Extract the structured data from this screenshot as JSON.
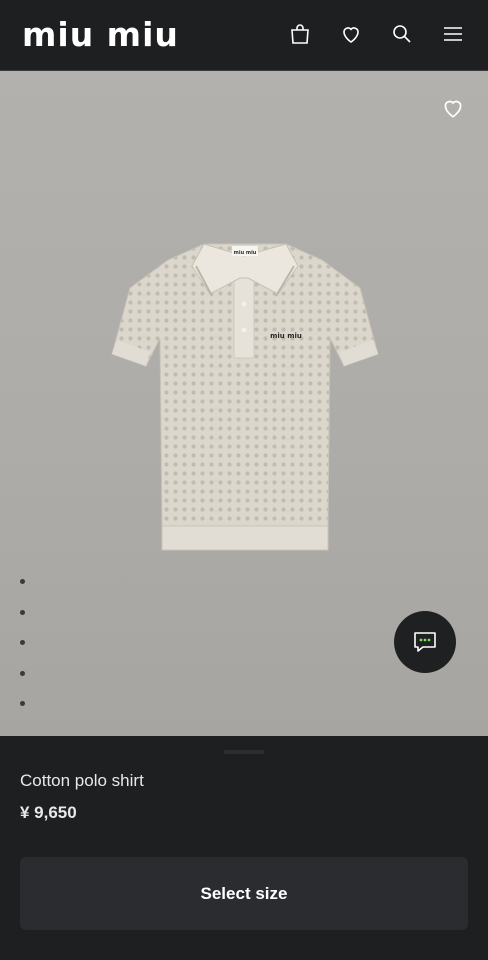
{
  "header": {
    "logo_text": "miu miu",
    "icons": [
      "shopping-bag-icon",
      "heart-icon",
      "search-icon",
      "menu-icon"
    ]
  },
  "product": {
    "name": "Cotton polo shirt",
    "price": "¥ 9,650",
    "image_alt": "Cotton polo shirt",
    "gallery_count": 5,
    "gallery_active_index": 0,
    "select_size_label": "Select size"
  },
  "colors": {
    "header_bg": "#1e1f21",
    "image_bg": "#b0aeaa",
    "button_bg": "#2b2c30",
    "chat_dot_accent": "#7ddc5a"
  }
}
